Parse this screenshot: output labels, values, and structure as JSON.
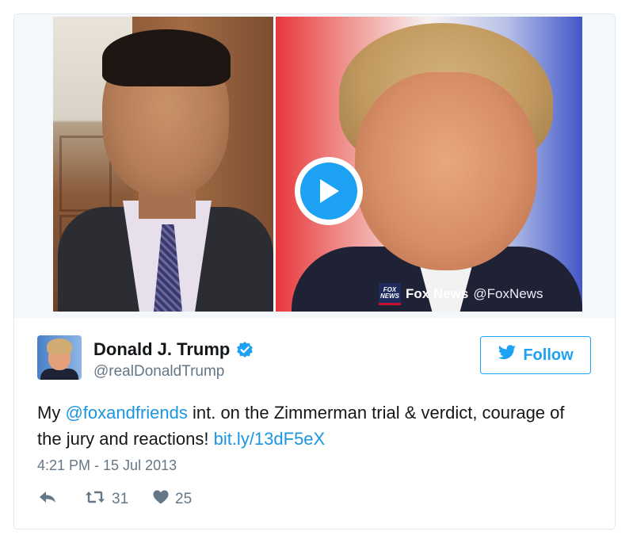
{
  "media": {
    "play_icon": "play-icon",
    "watermark": {
      "logo_line1": "FOX",
      "logo_line2": "NEWS",
      "name": "Fox News",
      "handle": "@FoxNews"
    }
  },
  "user": {
    "name": "Donald J. Trump",
    "handle": "@realDonaldTrump",
    "verified": true
  },
  "follow_button": {
    "label": "Follow",
    "icon": "twitter-bird-icon"
  },
  "tweet": {
    "text_1": "My ",
    "mention": "@foxandfriends",
    "text_2": " int. on the Zimmerman trial & verdict, courage of the jury and reactions! ",
    "link": "bit.ly/13dF5eX",
    "timestamp": "4:21 PM - 15 Jul 2013"
  },
  "actions": {
    "reply_icon": "reply-icon",
    "retweet_icon": "retweet-icon",
    "retweet_count": "31",
    "like_icon": "heart-icon",
    "like_count": "25"
  },
  "colors": {
    "accent": "#1da1f2",
    "link": "#1b95e0",
    "secondary_text": "#657786",
    "border": "#e1e8ed"
  }
}
